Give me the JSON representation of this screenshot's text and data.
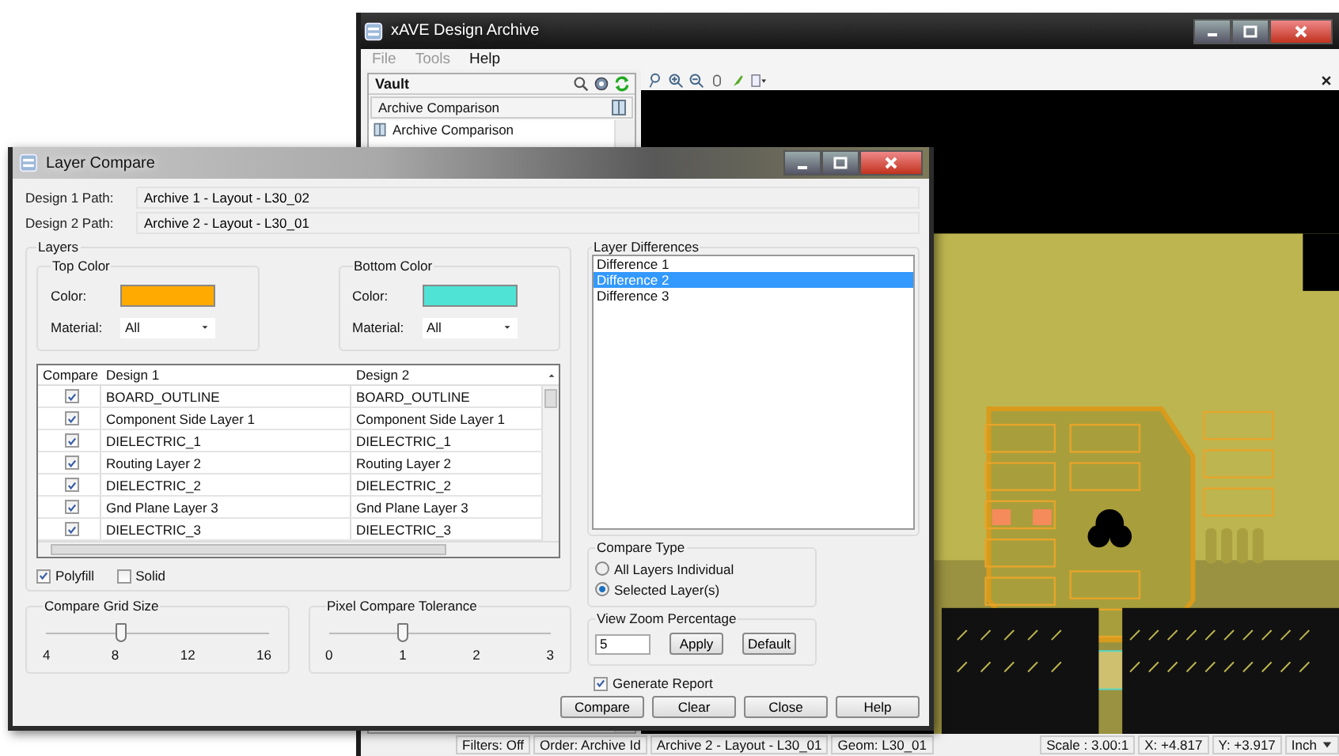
{
  "main_window": {
    "title": "xAVE Design Archive",
    "menu": [
      {
        "label": "File",
        "disabled": true
      },
      {
        "label": "Tools",
        "disabled": true
      },
      {
        "label": "Help",
        "disabled": false
      }
    ],
    "vault": {
      "title": "Vault",
      "header": "Archive Comparison",
      "tree": [
        {
          "label": "Archive Comparison"
        }
      ]
    },
    "status_bar": [
      {
        "text": "Filters: Off"
      },
      {
        "text": "Order: Archive Id"
      },
      {
        "text": "Archive 2 - Layout - L30_01"
      },
      {
        "text": "Geom: L30_01"
      },
      {
        "text": "Scale : 3.00:1"
      },
      {
        "text": "X: +4.817"
      },
      {
        "text": "Y: +3.917"
      },
      {
        "text": "Inch"
      }
    ]
  },
  "dialog": {
    "title": "Layer Compare",
    "paths": [
      {
        "label": "Design 1 Path:",
        "value": "Archive 1 - Layout - L30_02"
      },
      {
        "label": "Design 2 Path:",
        "value": "Archive 2 - Layout - L30_01"
      }
    ],
    "layers": {
      "title": "Layers",
      "colors": [
        {
          "title": "Top Color",
          "color_label": "Color:",
          "color": "#ffaa00",
          "material_label": "Material:",
          "material": "All"
        },
        {
          "title": "Bottom Color",
          "color_label": "Color:",
          "color": "#4fe3d6",
          "material_label": "Material:",
          "material": "All"
        }
      ],
      "table": {
        "columns": [
          "Compare",
          "Design 1",
          "Design 2"
        ],
        "rows": [
          {
            "checked": true,
            "design_1": "BOARD_OUTLINE",
            "design_2": "BOARD_OUTLINE"
          },
          {
            "checked": true,
            "design_1": "Component Side Layer 1",
            "design_2": "Component Side Layer 1"
          },
          {
            "checked": true,
            "design_1": "DIELECTRIC_1",
            "design_2": "DIELECTRIC_1"
          },
          {
            "checked": true,
            "design_1": "Routing Layer 2",
            "design_2": "Routing Layer 2"
          },
          {
            "checked": true,
            "design_1": "DIELECTRIC_2",
            "design_2": "DIELECTRIC_2"
          },
          {
            "checked": true,
            "design_1": "Gnd Plane Layer 3",
            "design_2": "Gnd Plane Layer 3"
          },
          {
            "checked": true,
            "design_1": "DIELECTRIC_3",
            "design_2": "DIELECTRIC_3"
          }
        ]
      },
      "options": [
        {
          "label": "Polyfill",
          "checked": true
        },
        {
          "label": "Solid",
          "checked": false
        }
      ]
    },
    "sliders": [
      {
        "title": "Compare Grid Size",
        "level": 0.333,
        "ticks": [
          "4",
          "8",
          "12",
          "16"
        ]
      },
      {
        "title": "Pixel Compare Tolerance",
        "level": 0.333,
        "ticks": [
          "0",
          "1",
          "2",
          "3"
        ]
      }
    ],
    "differences": {
      "title": "Layer Differences",
      "items": [
        {
          "label": "Difference 1",
          "selected": false
        },
        {
          "label": "Difference 2",
          "selected": true
        },
        {
          "label": "Difference 3",
          "selected": false
        }
      ]
    },
    "compare_type": {
      "title": "Compare Type",
      "options": [
        {
          "label": "All Layers Individual",
          "selected": false
        },
        {
          "label": "Selected Layer(s)",
          "selected": true
        }
      ]
    },
    "zoom": {
      "title": "View Zoom Percentage",
      "value": "5",
      "buttons": [
        "Apply",
        "Default"
      ]
    },
    "generate_report": {
      "label": "Generate Report",
      "checked": true
    },
    "buttons": [
      "Compare",
      "Clear",
      "Close",
      "Help"
    ]
  }
}
